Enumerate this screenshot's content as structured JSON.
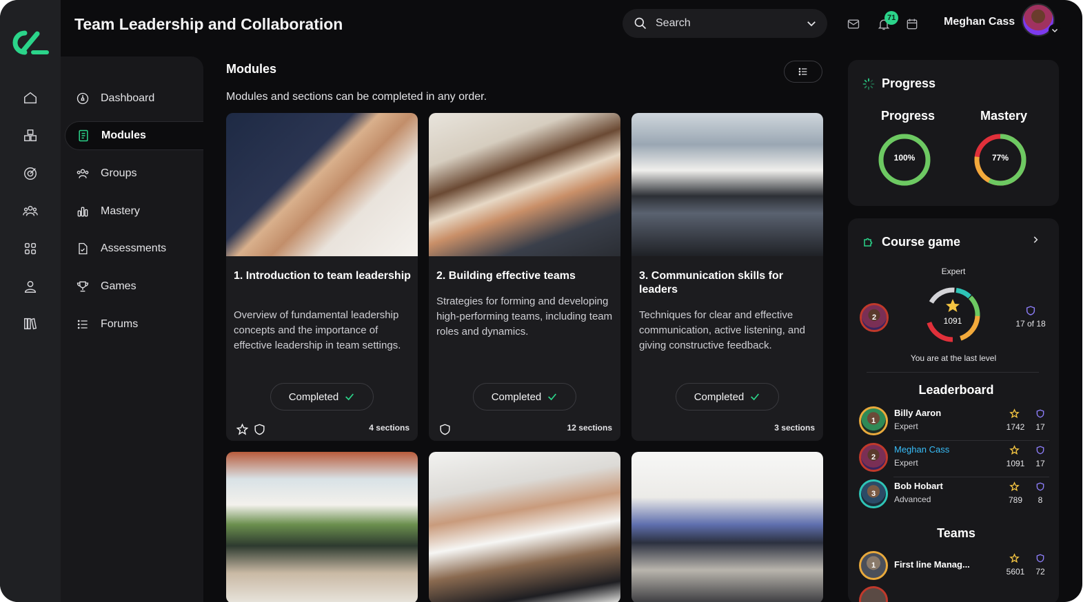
{
  "app": {
    "title": "Team Leadership and Collaboration"
  },
  "search": {
    "placeholder": "Search"
  },
  "header": {
    "notification_count": "71",
    "user_name": "Meghan Cass"
  },
  "sidebar": {
    "items": [
      {
        "label": "Dashboard",
        "icon": "dashboard-icon"
      },
      {
        "label": "Modules",
        "icon": "book-icon",
        "active": true
      },
      {
        "label": "Groups",
        "icon": "groups-icon"
      },
      {
        "label": "Mastery",
        "icon": "bar-chart-icon"
      },
      {
        "label": "Assessments",
        "icon": "document-icon"
      },
      {
        "label": "Games",
        "icon": "trophy-icon"
      },
      {
        "label": "Forums",
        "icon": "list-icon"
      }
    ]
  },
  "modules": {
    "title": "Modules",
    "subtitle": "Modules and sections can be completed in any order.",
    "cards": [
      {
        "title": "1. Introduction to team leadership",
        "description": "Overview of fundamental leadership concepts and the importance of effective leadership in team settings.",
        "status": "Completed",
        "sections": "4 sections"
      },
      {
        "title": "2. Building effective teams",
        "description": "Strategies for forming and developing high-performing teams, including team roles and dynamics.",
        "status": "Completed",
        "sections": "12 sections"
      },
      {
        "title": "3. Communication skills for leaders",
        "description": "Techniques for clear and effective communication, active listening, and giving constructive feedback.",
        "status": "Completed",
        "sections": "3 sections"
      }
    ]
  },
  "progress_panel": {
    "title": "Progress",
    "progress_label": "Progress",
    "progress_value": "100%",
    "progress_fraction": 1.0,
    "mastery_label": "Mastery",
    "mastery_value": "77%",
    "mastery_fraction": 0.77
  },
  "course_game": {
    "title": "Course game",
    "level_name": "Expert",
    "score": "1091",
    "rank_badge": "2",
    "levels_text": "17 of 18",
    "status_text": "You are at the last level"
  },
  "leaderboard": {
    "title": "Leaderboard",
    "rows": [
      {
        "rank": "1",
        "name": "Billy Aaron",
        "level": "Expert",
        "points": "1742",
        "badges": "17",
        "color": "#e8a93c"
      },
      {
        "rank": "2",
        "name": "Meghan Cass",
        "level": "Expert",
        "points": "1091",
        "badges": "17",
        "color": "#c0392b",
        "highlight": true
      },
      {
        "rank": "3",
        "name": "Bob Hobart",
        "level": "Advanced",
        "points": "789",
        "badges": "8",
        "color": "#2ec4b6"
      }
    ]
  },
  "teams": {
    "title": "Teams",
    "rows": [
      {
        "rank": "1",
        "name": "First line Manag...",
        "points": "5601",
        "badges": "72"
      }
    ]
  },
  "colors": {
    "accent": "#2bd48a",
    "star": "#f5c542",
    "shield": "#8b7cf6",
    "highlight_name": "#38bdf8"
  }
}
